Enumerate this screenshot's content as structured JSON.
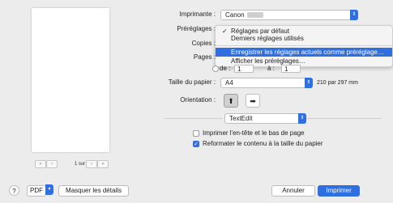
{
  "preview": {
    "page_counter": "1 sur 1",
    "first_icon": "first-page-icon",
    "prev_icon": "previous-page-icon",
    "next_icon": "next-page-icon",
    "last_icon": "last-page-icon"
  },
  "printer": {
    "label": "Imprimante :",
    "value": "Canon"
  },
  "presets": {
    "label": "Préréglages :",
    "menu": {
      "checked_item": "Réglages par défaut",
      "item_last_used": "Derniers réglages utilisés",
      "item_save": "Enregistrer les réglages actuels comme préréglage…",
      "item_show": "Afficher les préréglages…"
    }
  },
  "copies": {
    "label": "Copies :"
  },
  "pages": {
    "label": "Pages :",
    "from_label": "de :",
    "from_value": "1",
    "to_label": "à :",
    "to_value": "1"
  },
  "paper": {
    "label": "Taille du papier :",
    "value": "A4",
    "dims": "210 par 297 mm"
  },
  "orientation": {
    "label": "Orientation :",
    "portrait_icon": "portrait-icon",
    "landscape_icon": "landscape-icon"
  },
  "app_menu": {
    "value": "TextEdit"
  },
  "options": {
    "header_footer": {
      "label": "Imprimer l'en-tête et le bas de page",
      "checked": false
    },
    "reflow": {
      "label": "Reformater le contenu à la taille du papier",
      "checked": true
    }
  },
  "footer": {
    "help": "?",
    "pdf": "PDF",
    "hide_details": "Masquer les détails",
    "cancel": "Annuler",
    "print": "Imprimer"
  },
  "colors": {
    "accent": "#2f6fe0"
  }
}
